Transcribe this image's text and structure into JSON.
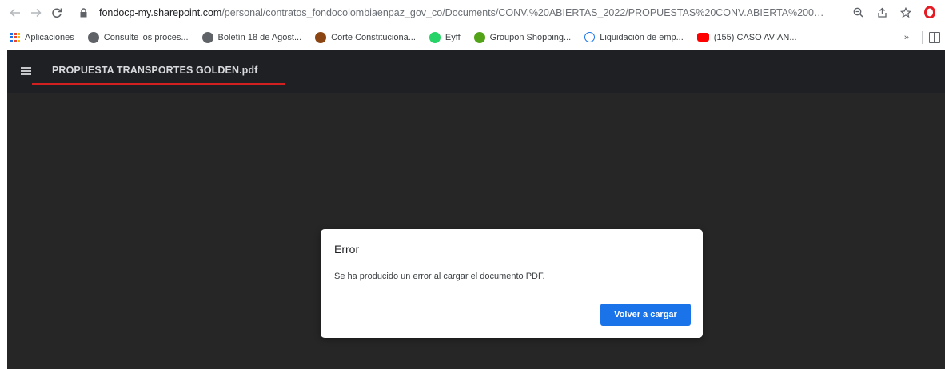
{
  "browser": {
    "url_host": "fondocp-my.sharepoint.com",
    "url_path": "/personal/contratos_fondocolombiaenpaz_gov_co/Documents/CONV.%20ABIERTAS_2022/PROPUESTAS%20CONV.ABIERTA%200…",
    "nav_icons": [
      "back-arrow-icon",
      "forward-arrow-icon",
      "reload-icon",
      "lock-icon"
    ],
    "toolbar_icons": [
      "zoom-icon",
      "share-icon",
      "star-icon",
      "opera-icon"
    ]
  },
  "bookmarks": {
    "apps_label": "Aplicaciones",
    "items": [
      {
        "label": "Consulte los proces...",
        "icon": "globe-icon",
        "color": "#5f6368"
      },
      {
        "label": "Boletín 18 de Agost...",
        "icon": "globe-icon",
        "color": "#5f6368"
      },
      {
        "label": "Corte Constituciona...",
        "icon": "court-icon",
        "color": "#8b4513"
      },
      {
        "label": "Eyff",
        "icon": "chat-icon",
        "color": "#25d366"
      },
      {
        "label": "Groupon Shopping...",
        "icon": "groupon-icon",
        "color": "#53a318"
      },
      {
        "label": "Liquidación de emp...",
        "icon": "at-icon",
        "color": "#1a73e8"
      },
      {
        "label": "(155) CASO AVIAN...",
        "icon": "youtube-icon",
        "color": "#ff0000"
      }
    ],
    "more_label": "»"
  },
  "viewer": {
    "document_title": "PROPUESTA TRANSPORTES GOLDEN.pdf",
    "background_color": "#262626",
    "header_color": "#1f2023",
    "underline_color": "#d21f1f"
  },
  "dialog": {
    "title": "Error",
    "message": "Se ha producido un error al cargar el documento PDF.",
    "button_label": "Volver a cargar",
    "button_color": "#1a73e8"
  }
}
